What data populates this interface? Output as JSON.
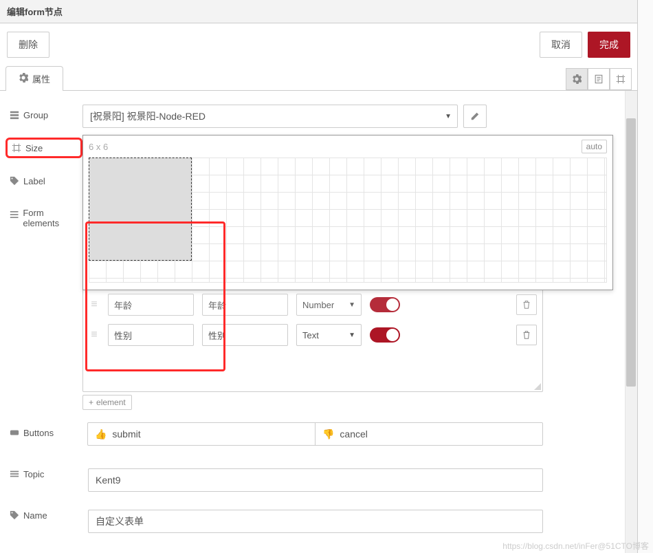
{
  "header": {
    "title": "编辑form节点"
  },
  "toolbar": {
    "delete_label": "删除",
    "cancel_label": "取消",
    "done_label": "完成"
  },
  "tabs": {
    "properties_label": "属性"
  },
  "form_labels": {
    "group": "Group",
    "size": "Size",
    "label": "Label",
    "form_elements": "Form elements",
    "buttons": "Buttons",
    "topic": "Topic",
    "name": "Name"
  },
  "group": {
    "selected": "[祝景阳] 祝景阳-Node-RED"
  },
  "size": {
    "display": "6 x 6",
    "auto_label": "auto",
    "cols": 6,
    "rows": 6
  },
  "elements": [
    {
      "label": "年龄",
      "name": "年龄",
      "type": "Number",
      "required": true
    },
    {
      "label": "性别",
      "name": "性别",
      "type": "Text",
      "required": true
    }
  ],
  "add_element_label": "element",
  "buttons": {
    "submit": "submit",
    "cancel": "cancel"
  },
  "topic": {
    "value": "Kent9"
  },
  "name_field": {
    "value": "自定义表单"
  },
  "watermark": "https://blog.csdn.net/inFer@51CTO博客"
}
